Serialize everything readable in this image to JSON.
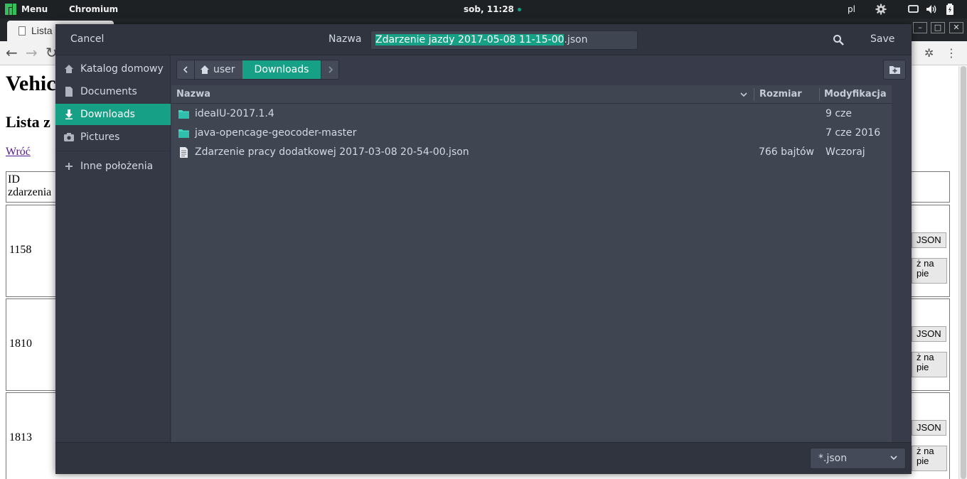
{
  "panel": {
    "menu_label": "Menu",
    "app_label": "Chromium",
    "clock": "sob, 11:28",
    "lang": "pl"
  },
  "browser": {
    "tab_title": "Lista",
    "page_title": "Vehic",
    "page_subtitle": "Lista z",
    "back_link": "Wróć",
    "table_header": "ID zdarzenia",
    "rows": [
      {
        "id": "1158",
        "json_btn": "JSON",
        "map_btn": "ż na\npie"
      },
      {
        "id": "1810",
        "json_btn": "JSON",
        "map_btn": "ż na\npie"
      },
      {
        "id": "1813",
        "json_btn": "JSON",
        "map_btn": "ż na\npie"
      }
    ]
  },
  "dialog": {
    "cancel_label": "Cancel",
    "name_label": "Nazwa",
    "filename_selected": "Zdarzenie jazdy 2017-05-08 11-15-00",
    "filename_ext": ".json",
    "save_label": "Save",
    "sidebar": [
      {
        "label": "Katalog domowy",
        "icon": "home-icon",
        "active": false
      },
      {
        "label": "Documents",
        "icon": "document-icon",
        "active": false
      },
      {
        "label": "Downloads",
        "icon": "download-icon",
        "active": true
      },
      {
        "label": "Pictures",
        "icon": "camera-icon",
        "active": false
      },
      {
        "label": "Inne położenia",
        "icon": "plus-icon",
        "active": false
      }
    ],
    "path": [
      {
        "label": "user",
        "icon": "home-icon",
        "active": false
      },
      {
        "label": "Downloads",
        "active": true
      }
    ],
    "columns": {
      "name": "Nazwa",
      "size": "Rozmiar",
      "modified": "Modyfikacja"
    },
    "files": [
      {
        "name": "ideaIU-2017.1.4",
        "type": "folder",
        "size": "",
        "modified": "9 cze"
      },
      {
        "name": "java-opencage-geocoder-master",
        "type": "folder",
        "size": "",
        "modified": "7 cze 2016"
      },
      {
        "name": "Zdarzenie pracy dodatkowej 2017-03-08 20-54-00.json",
        "type": "file",
        "size": "766 bajtów",
        "modified": "Wczoraj"
      }
    ],
    "filter": "*.json"
  },
  "colors": {
    "accent": "#16a085",
    "dialog_bg": "#383c4a",
    "header_bg": "#2f343f",
    "list_bg": "#404552",
    "folder": "#41d6c3",
    "text": "#d3dae3"
  }
}
